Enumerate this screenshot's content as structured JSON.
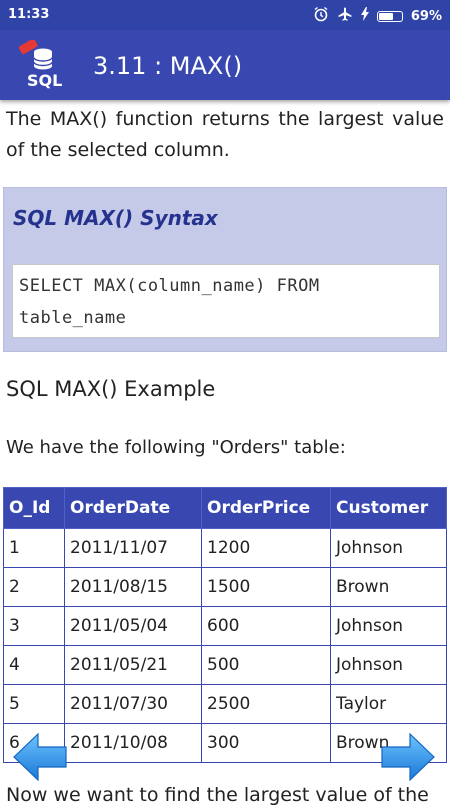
{
  "status_bar": {
    "time": "11:33",
    "battery_percent": "69%",
    "battery_level": 0.69,
    "icons": [
      "alarm-icon",
      "airplane-icon",
      "charging-icon",
      "battery-icon"
    ]
  },
  "app_bar": {
    "title": "3.11 : MAX()",
    "logo_text": "SQL",
    "logo_badge": "new"
  },
  "intro": "The MAX() function returns the largest value of the selected column.",
  "syntax": {
    "title": "SQL MAX() Syntax",
    "code_line1": "SELECT MAX(column_name) FROM",
    "code_line2": "table_name"
  },
  "example_heading": "SQL MAX() Example",
  "table_intro": "We have the following \"Orders\" table:",
  "table": {
    "headers": [
      "O_Id",
      "OrderDate",
      "OrderPrice",
      "Customer"
    ],
    "rows": [
      [
        "1",
        "2011/11/07",
        "1200",
        "Johnson"
      ],
      [
        "2",
        "2011/08/15",
        "1500",
        "Brown"
      ],
      [
        "3",
        "2011/05/04",
        "600",
        "Johnson"
      ],
      [
        "4",
        "2011/05/21",
        "500",
        "Johnson"
      ],
      [
        "5",
        "2011/07/30",
        "2500",
        "Taylor"
      ],
      [
        "6",
        "2011/10/08",
        "300",
        "Brown"
      ]
    ]
  },
  "bottom_text": "Now we want to find the largest value of the",
  "colors": {
    "primary": "#3848b0",
    "status_bar": "#2f44a6",
    "syntax_bg": "#c5cae9",
    "syntax_title": "#25338f",
    "arrow": "#2b8fe0"
  }
}
